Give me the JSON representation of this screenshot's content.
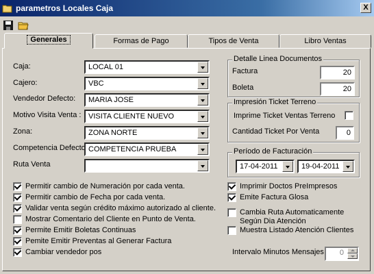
{
  "window": {
    "title": "parametros Locales Caja",
    "close_label": "X"
  },
  "toolbar": {
    "icons": [
      "save-icon",
      "open-folder-icon"
    ]
  },
  "tabs": [
    "Generales",
    "Formas de Pago",
    "Tipos de Venta",
    "Libro Ventas"
  ],
  "fields": {
    "caja": {
      "label": "Caja:",
      "value": "LOCAL 01"
    },
    "cajero": {
      "label": "Cajero:",
      "value": "VBC"
    },
    "vendedor": {
      "label": "Vendedor Defecto:",
      "value": "MARIA JOSE"
    },
    "motivo": {
      "label": "Motivo Visita Venta :",
      "value": "VISITA CLIENTE NUEVO"
    },
    "zona": {
      "label": "Zona:",
      "value": "ZONA NORTE"
    },
    "competencia": {
      "label": "Competencia Defecto",
      "value": "COMPETENCIA PRUEBA"
    },
    "ruta": {
      "label": "Ruta Venta",
      "value": ""
    }
  },
  "left_checks": [
    {
      "label": "Permitir cambio de Numeración por cada venta.",
      "checked": true
    },
    {
      "label": "Permitir cambio de Fecha por cada venta.",
      "checked": true
    },
    {
      "label": "Validar venta según crédito máximo autorizado al cliente.",
      "checked": true
    },
    {
      "label": "Mostrar Comentario del Cliente en Punto de Venta.",
      "checked": false
    },
    {
      "label": "Permite Emitir Boletas Continuas",
      "checked": true
    },
    {
      "label": "Pemite Emitir Preventas al Generar Factura",
      "checked": true
    },
    {
      "label": "Cambiar vendedor pos",
      "checked": true
    }
  ],
  "detalle": {
    "title": "Detalle Linea Documentos",
    "factura_label": "Factura",
    "factura_value": "20",
    "boleta_label": "Boleta",
    "boleta_value": "20"
  },
  "ticket": {
    "title": "Impresión Ticket Terreno",
    "imprime_label": "Imprime Ticket Ventas Terreno",
    "imprime_checked": false,
    "cantidad_label": "Cantidad Ticket Por Venta",
    "cantidad_value": "0"
  },
  "periodo": {
    "title": "Período de Facturación",
    "desde": "17-04-2011",
    "hasta": "19-04-2011"
  },
  "right_checks": [
    {
      "label": "Imprimir Doctos PreImpresos",
      "checked": true
    },
    {
      "label": "Emite Factura Glosa",
      "checked": true
    },
    {
      "label": "Cambia Ruta Automaticamente\nSegún Dia Atención",
      "checked": false
    },
    {
      "label": "Muestra Listado Atención Clientes",
      "checked": false
    }
  ],
  "intervalo": {
    "label": "Intervalo Minutos Mensajes",
    "value": "0"
  }
}
